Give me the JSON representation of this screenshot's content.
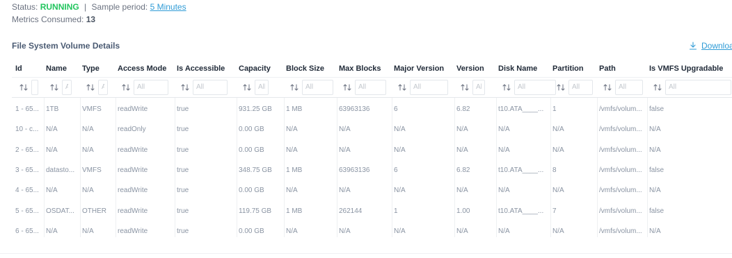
{
  "status": {
    "label": "Status:",
    "value": "RUNNING",
    "separator": "|",
    "sample_label": "Sample period:",
    "sample_value": "5 Minutes",
    "metrics_label": "Metrics Consumed:",
    "metrics_value": "13",
    "running_color": "#22c55e",
    "link_color": "#2f9bd6"
  },
  "section": {
    "title": "File System Volume Details",
    "download_label": "Download",
    "download_icon": "download-icon"
  },
  "table": {
    "filter_placeholder": "All",
    "sort_icon": "sort-arrows-icon",
    "columns": [
      {
        "key": "id",
        "label": "Id",
        "placeholder": ""
      },
      {
        "key": "name",
        "label": "Name",
        "placeholder": "A"
      },
      {
        "key": "type",
        "label": "Type",
        "placeholder": "A"
      },
      {
        "key": "access_mode",
        "label": "Access Mode",
        "placeholder": "All"
      },
      {
        "key": "is_accessible",
        "label": "Is Accessible",
        "placeholder": "All"
      },
      {
        "key": "capacity",
        "label": "Capacity",
        "placeholder": "All"
      },
      {
        "key": "block_size",
        "label": "Block Size",
        "placeholder": "All"
      },
      {
        "key": "max_blocks",
        "label": "Max Blocks",
        "placeholder": "All"
      },
      {
        "key": "major_version",
        "label": "Major Version",
        "placeholder": "All"
      },
      {
        "key": "version",
        "label": "Version",
        "placeholder": "All"
      },
      {
        "key": "disk_name",
        "label": "Disk Name",
        "placeholder": "All"
      },
      {
        "key": "partition",
        "label": "Partition",
        "placeholder": "All"
      },
      {
        "key": "path",
        "label": "Path",
        "placeholder": "All"
      },
      {
        "key": "is_vmfs_upgradable",
        "label": "Is VMFS Upgradable",
        "placeholder": "All"
      }
    ],
    "rows": [
      [
        "1 - 65...",
        "1TB",
        "VMFS",
        "readWrite",
        "true",
        "931.25 GB",
        "1 MB",
        "63963136",
        "6",
        "6.82",
        "t10.ATA____...",
        "1",
        "/vmfs/volum...",
        "false"
      ],
      [
        "10 - c...",
        "N/A",
        "N/A",
        "readOnly",
        "true",
        "0.00 GB",
        "N/A",
        "N/A",
        "N/A",
        "N/A",
        "N/A",
        "N/A",
        "/vmfs/volum...",
        "N/A"
      ],
      [
        "2 - 65...",
        "N/A",
        "N/A",
        "readWrite",
        "true",
        "0.00 GB",
        "N/A",
        "N/A",
        "N/A",
        "N/A",
        "N/A",
        "N/A",
        "/vmfs/volum...",
        "N/A"
      ],
      [
        "3 - 65...",
        "datasto...",
        "VMFS",
        "readWrite",
        "true",
        "348.75 GB",
        "1 MB",
        "63963136",
        "6",
        "6.82",
        "t10.ATA____...",
        "8",
        "/vmfs/volum...",
        "false"
      ],
      [
        "4 - 65...",
        "N/A",
        "N/A",
        "readWrite",
        "true",
        "0.00 GB",
        "N/A",
        "N/A",
        "N/A",
        "N/A",
        "N/A",
        "N/A",
        "/vmfs/volum...",
        "N/A"
      ],
      [
        "5 - 65...",
        "OSDAT...",
        "OTHER",
        "readWrite",
        "true",
        "119.75 GB",
        "1 MB",
        "262144",
        "1",
        "1.00",
        "t10.ATA____...",
        "7",
        "/vmfs/volum...",
        "false"
      ],
      [
        "6 - 65...",
        "N/A",
        "N/A",
        "readWrite",
        "true",
        "0.00 GB",
        "N/A",
        "N/A",
        "N/A",
        "N/A",
        "N/A",
        "N/A",
        "/vmfs/volum...",
        "N/A"
      ]
    ]
  }
}
